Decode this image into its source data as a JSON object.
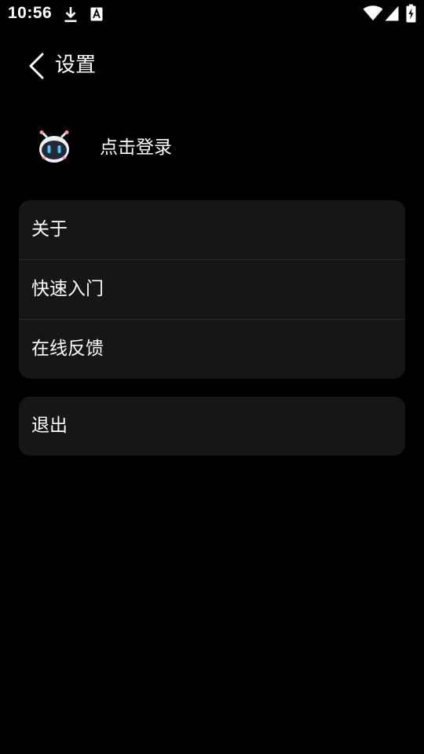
{
  "status_bar": {
    "time": "10:56",
    "icons": [
      "download-icon",
      "a-notification-icon",
      "wifi-icon",
      "cell-signal-icon",
      "battery-charging-icon"
    ]
  },
  "header": {
    "title": "设置",
    "back_icon": "chevron-left-icon"
  },
  "profile": {
    "login_label": "点击登录",
    "avatar_icon": "robot-avatar-icon"
  },
  "menu": {
    "items": [
      {
        "label": "关于"
      },
      {
        "label": "快速入门"
      },
      {
        "label": "在线反馈"
      }
    ]
  },
  "logout": {
    "label": "退出"
  },
  "colors": {
    "background": "#000000",
    "card": "#161618",
    "divider": "#2a2a2d",
    "text": "#ffffff"
  }
}
